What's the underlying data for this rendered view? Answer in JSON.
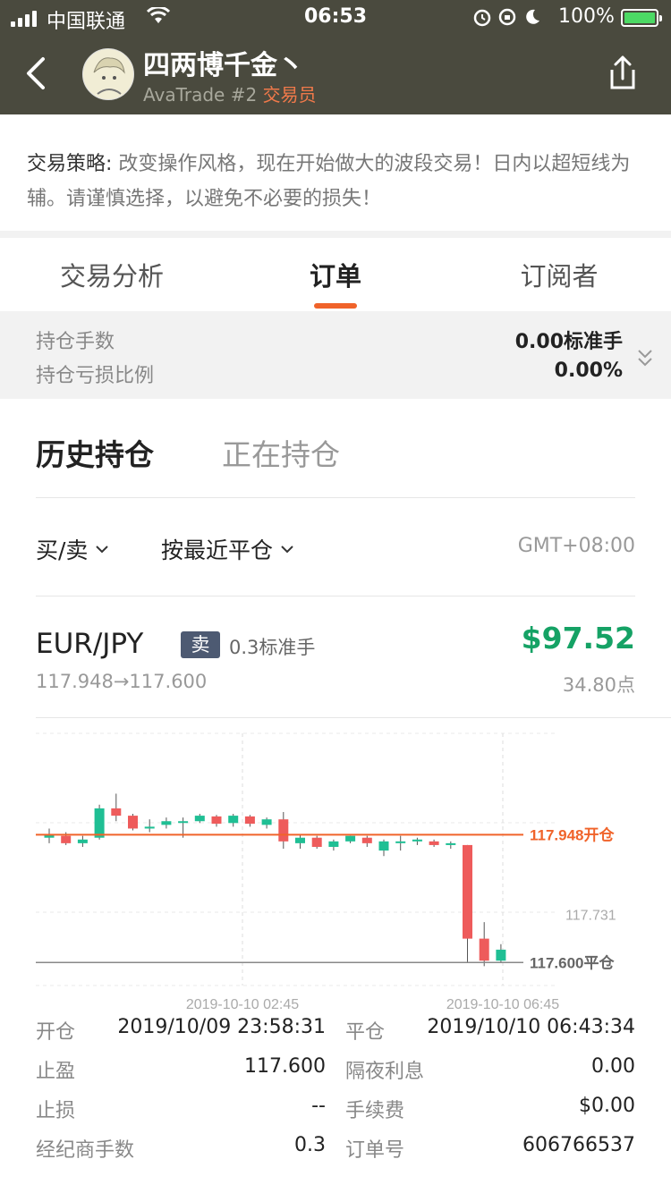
{
  "status_bar": {
    "carrier": "中国联通",
    "time": "06:53",
    "battery_percent": "100%"
  },
  "header": {
    "trader_name": "四两博千金丶",
    "account": "AvaTrade #2",
    "role": "交易员"
  },
  "strategy": {
    "label": "交易策略:",
    "text": "改变操作风格，现在开始做大的波段交易！日内以超短线为辅。请谨慎选择，以避免不必要的损失！"
  },
  "tabs": [
    {
      "label": "交易分析"
    },
    {
      "label": "订单"
    },
    {
      "label": "订阅者"
    }
  ],
  "summary": {
    "lots_label": "持仓手数",
    "lots_value": "0.00标准手",
    "pl_ratio_label": "持仓亏损比例",
    "pl_ratio_value": "0.00%"
  },
  "subtabs": {
    "history": "历史持仓",
    "open": "正在持仓"
  },
  "filters": {
    "side": "买/卖",
    "sort": "按最近平仓",
    "timezone": "GMT+08:00"
  },
  "order": {
    "symbol": "EUR/JPY",
    "side": "卖",
    "lots": "0.3标准手",
    "profit": "$97.52",
    "price_path": "117.948→117.600",
    "points": "34.80点"
  },
  "chart_data": {
    "type": "candlestick",
    "open_line_label": "117.948开仓",
    "close_line_label": "117.600平仓",
    "mid_price_label": "117.731",
    "x_tick_labels": [
      "2019-10-10 02:45",
      "2019-10-10 06:45"
    ],
    "open_price": 117.948,
    "close_price": 117.6,
    "ylim": [
      117.53,
      118.2
    ],
    "candles": [
      {
        "o": 117.94,
        "c": 117.95,
        "h": 117.965,
        "l": 117.925,
        "up": true
      },
      {
        "o": 117.945,
        "c": 117.925,
        "h": 117.955,
        "l": 117.92,
        "up": false
      },
      {
        "o": 117.925,
        "c": 117.935,
        "h": 117.945,
        "l": 117.915,
        "up": true
      },
      {
        "o": 117.94,
        "c": 118.02,
        "h": 118.03,
        "l": 117.935,
        "up": true
      },
      {
        "o": 118.02,
        "c": 118.0,
        "h": 118.06,
        "l": 117.985,
        "up": false
      },
      {
        "o": 118.0,
        "c": 117.965,
        "h": 118.005,
        "l": 117.96,
        "up": false
      },
      {
        "o": 117.965,
        "c": 117.97,
        "h": 117.99,
        "l": 117.955,
        "up": true
      },
      {
        "o": 117.975,
        "c": 117.985,
        "h": 117.995,
        "l": 117.965,
        "up": true
      },
      {
        "o": 117.985,
        "c": 117.985,
        "h": 117.995,
        "l": 117.94,
        "up": true
      },
      {
        "o": 117.985,
        "c": 118.0,
        "h": 118.005,
        "l": 117.98,
        "up": true
      },
      {
        "o": 117.998,
        "c": 117.978,
        "h": 118.002,
        "l": 117.97,
        "up": false
      },
      {
        "o": 117.98,
        "c": 118.0,
        "h": 118.005,
        "l": 117.97,
        "up": true
      },
      {
        "o": 117.998,
        "c": 117.978,
        "h": 118.002,
        "l": 117.97,
        "up": false
      },
      {
        "o": 117.975,
        "c": 117.99,
        "h": 117.995,
        "l": 117.965,
        "up": true
      },
      {
        "o": 117.99,
        "c": 117.93,
        "h": 118.01,
        "l": 117.91,
        "up": false
      },
      {
        "o": 117.925,
        "c": 117.94,
        "h": 117.95,
        "l": 117.91,
        "up": true
      },
      {
        "o": 117.94,
        "c": 117.915,
        "h": 117.945,
        "l": 117.91,
        "up": false
      },
      {
        "o": 117.915,
        "c": 117.93,
        "h": 117.935,
        "l": 117.905,
        "up": true
      },
      {
        "o": 117.93,
        "c": 117.945,
        "h": 117.945,
        "l": 117.925,
        "up": true
      },
      {
        "o": 117.94,
        "c": 117.925,
        "h": 117.945,
        "l": 117.915,
        "up": false
      },
      {
        "o": 117.905,
        "c": 117.93,
        "h": 117.935,
        "l": 117.89,
        "up": true
      },
      {
        "o": 117.93,
        "c": 117.93,
        "h": 117.945,
        "l": 117.905,
        "up": true
      },
      {
        "o": 117.93,
        "c": 117.935,
        "h": 117.94,
        "l": 117.92,
        "up": true
      },
      {
        "o": 117.93,
        "c": 117.92,
        "h": 117.935,
        "l": 117.915,
        "up": false
      },
      {
        "o": 117.92,
        "c": 117.925,
        "h": 117.93,
        "l": 117.91,
        "up": true
      },
      {
        "o": 117.92,
        "c": 117.665,
        "h": 117.92,
        "l": 117.6,
        "up": false
      },
      {
        "o": 117.665,
        "c": 117.605,
        "h": 117.71,
        "l": 117.59,
        "up": false
      },
      {
        "o": 117.605,
        "c": 117.635,
        "h": 117.65,
        "l": 117.6,
        "up": true
      }
    ]
  },
  "details": [
    {
      "label1": "开仓",
      "value1": "2019/10/09 23:58:31",
      "label2": "平仓",
      "value2": "2019/10/10 06:43:34"
    },
    {
      "label1": "止盈",
      "value1": "117.600",
      "label2": "隔夜利息",
      "value2": "0.00"
    },
    {
      "label1": "止损",
      "value1": "--",
      "label2": "手续费",
      "value2": "$0.00"
    },
    {
      "label1": "经纪商手数",
      "value1": "0.3",
      "label2": "订单号",
      "value2": "606766537"
    }
  ],
  "colors": {
    "header_bg": "#4a4a3e",
    "accent": "#f0632a",
    "up": "#1fbf94",
    "down": "#ee5b5b",
    "profit": "#15a265"
  }
}
